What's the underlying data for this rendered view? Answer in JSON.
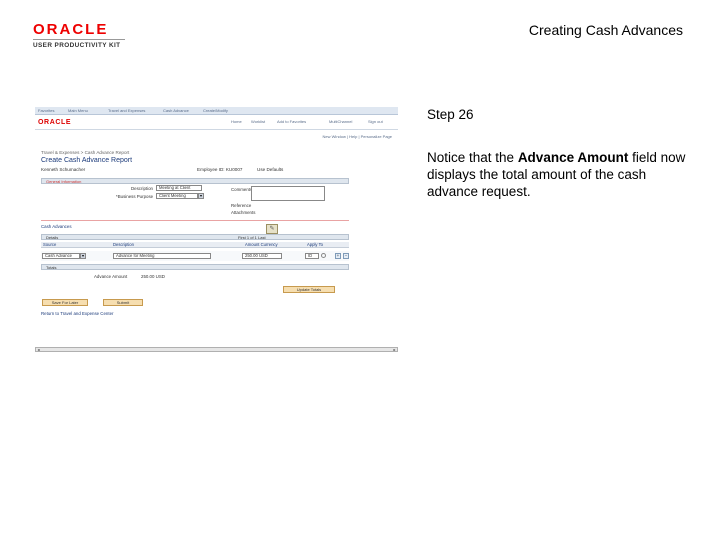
{
  "header": {
    "logo_brand": "ORACLE",
    "logo_sub": "USER PRODUCTIVITY KIT",
    "doc_title": "Creating Cash Advances"
  },
  "panel": {
    "step": "Step 26",
    "text_before": "Notice that the ",
    "text_bold": "Advance Amount",
    "text_after": " field now displays the total amount of the cash advance request."
  },
  "screenshot": {
    "topnav": [
      "Favorites",
      "Main Menu",
      "Travel and Expenses",
      "Cash Advance",
      "Create/Modify"
    ],
    "brand": "ORACLE",
    "header_links": [
      "Home",
      "Worklist",
      "Add to Favorites",
      "MultiChannel",
      "Sign out"
    ],
    "new_window_links": "New Window | Help | Personalize Page",
    "breadcrumb": "Travel & Expenses  > Cash Advance Report",
    "page_title": "Create Cash Advance Report",
    "employee_name": "Kenneth Schumacher",
    "employee_id": "Employee ID:  KU0007",
    "no_defaults": "Use Defaults",
    "general_section": "General Information",
    "description_label": "Description",
    "description_value": "Meeting at Client",
    "business_purpose_label": "*Business Purpose",
    "business_purpose_value": "Client Meeting",
    "comments_label": "Comments",
    "reference_label": "Reference",
    "attachments_label": "Attachments",
    "advances_section": "Cash Advances",
    "details_label": "Details",
    "grid_nav": "First  1 of 1  Last",
    "col_source": "Source",
    "col_description": "Description",
    "col_amount": "Amount Currency",
    "col_apply": "Apply To",
    "row_source": "Cash Advance",
    "row_description": "Advance for Meeting",
    "row_amount": "250.00 USD",
    "row_apply": "ID",
    "totals_section": "Totals",
    "advance_amount_label": "Advance Amount",
    "advance_amount_value": "250.00  USD",
    "update_totals": "Update Totals",
    "save_for_later": "Save For Later",
    "submit": "Submit",
    "return_link": "Return to Travel and Expense Center"
  }
}
